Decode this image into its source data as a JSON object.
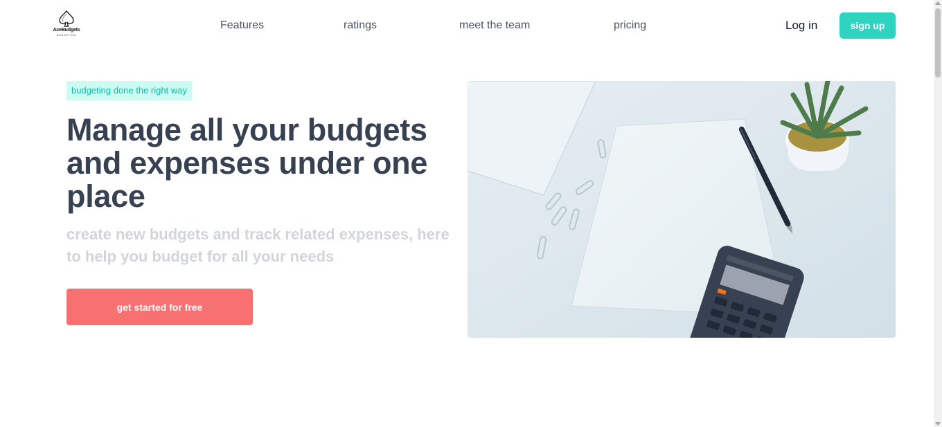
{
  "brand": {
    "name": "AceBudgets",
    "tagline": "BUDGETING"
  },
  "nav": {
    "links": [
      "Features",
      "ratings",
      "meet the team",
      "pricing"
    ],
    "login_label": "Log in",
    "signup_label": "sign up"
  },
  "hero": {
    "badge": "budgeting done the right way",
    "title": "Manage all your budgets and expenses under one place",
    "subtitle": "create new budgets and track related expenses, here to help you budget for all your needs",
    "cta_label": "get started for free",
    "image_icon": "desk-calculator-photo"
  },
  "colors": {
    "accent": "#2dd4bf",
    "cta": "#f87171",
    "badge_bg": "#ccfbf1",
    "heading": "#374151"
  }
}
